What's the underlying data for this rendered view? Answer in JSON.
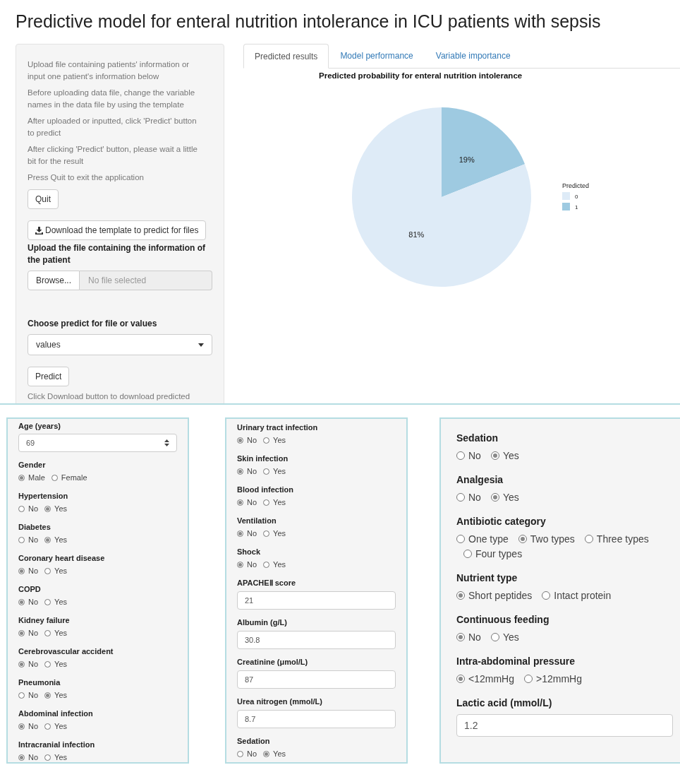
{
  "title": "Predictive model for enteral nutrition intolerance in ICU patients with sepsis",
  "sidebar": {
    "instructions": [
      "Upload file containing patients' information or input one patient's information below",
      "Before uploading data file, change the variable names in the data file by using the template",
      "After uploaded or inputted, click 'Predict' button to predict",
      "After clicking 'Predict' button, please wait a little bit for the result",
      "Press Quit to exit the application"
    ],
    "quit_button": "Quit",
    "download_button": "Download the template to predict for files",
    "upload_label": "Upload the file containing the information of the patient",
    "browse_button": "Browse...",
    "file_placeholder": "No file selected",
    "mode_label": "Choose predict for file or values",
    "mode_value": "values",
    "predict_button": "Predict",
    "download_note": "Click Download button to download predicted"
  },
  "tabs": [
    {
      "label": "Predicted results",
      "selected": true
    },
    {
      "label": "Model performance",
      "selected": false
    },
    {
      "label": "Variable importance",
      "selected": false
    }
  ],
  "chart": {
    "chart_data": {
      "type": "pie",
      "title": "Predicted probability for enteral nutrition intolerance",
      "categories": [
        "0",
        "1"
      ],
      "values": [
        81,
        19
      ],
      "value_labels": [
        "81%",
        "19%"
      ],
      "legend": {
        "title": "Predicted"
      }
    }
  },
  "panels": [
    {
      "fields": [
        {
          "kind": "number",
          "label": "Age (years)",
          "value": "69"
        },
        {
          "kind": "radio",
          "label": "Gender",
          "options": [
            {
              "label": "Male",
              "selected": true
            },
            {
              "label": "Female",
              "selected": false
            }
          ]
        },
        {
          "kind": "radio",
          "label": "Hypertension",
          "options": [
            {
              "label": "No",
              "selected": false
            },
            {
              "label": "Yes",
              "selected": true
            }
          ]
        },
        {
          "kind": "radio",
          "label": "Diabetes",
          "options": [
            {
              "label": "No",
              "selected": false
            },
            {
              "label": "Yes",
              "selected": true
            }
          ]
        },
        {
          "kind": "radio",
          "label": "Coronary heart disease",
          "options": [
            {
              "label": "No",
              "selected": true
            },
            {
              "label": "Yes",
              "selected": false
            }
          ]
        },
        {
          "kind": "radio",
          "label": "COPD",
          "options": [
            {
              "label": "No",
              "selected": true
            },
            {
              "label": "Yes",
              "selected": false
            }
          ]
        },
        {
          "kind": "radio",
          "label": "Kidney failure",
          "options": [
            {
              "label": "No",
              "selected": true
            },
            {
              "label": "Yes",
              "selected": false
            }
          ]
        },
        {
          "kind": "radio",
          "label": "Cerebrovascular accident",
          "options": [
            {
              "label": "No",
              "selected": true
            },
            {
              "label": "Yes",
              "selected": false
            }
          ]
        },
        {
          "kind": "radio",
          "label": "Pneumonia",
          "options": [
            {
              "label": "No",
              "selected": false
            },
            {
              "label": "Yes",
              "selected": true
            }
          ]
        },
        {
          "kind": "radio",
          "label": "Abdominal infection",
          "options": [
            {
              "label": "No",
              "selected": true
            },
            {
              "label": "Yes",
              "selected": false
            }
          ]
        },
        {
          "kind": "radio",
          "label": "Intracranial infection",
          "options": [
            {
              "label": "No",
              "selected": true
            },
            {
              "label": "Yes",
              "selected": false
            }
          ]
        }
      ]
    },
    {
      "fields": [
        {
          "kind": "radio",
          "label": "Urinary tract infection",
          "options": [
            {
              "label": "No",
              "selected": true
            },
            {
              "label": "Yes",
              "selected": false
            }
          ]
        },
        {
          "kind": "radio",
          "label": "Skin infection",
          "options": [
            {
              "label": "No",
              "selected": true
            },
            {
              "label": "Yes",
              "selected": false
            }
          ]
        },
        {
          "kind": "radio",
          "label": "Blood infection",
          "options": [
            {
              "label": "No",
              "selected": true
            },
            {
              "label": "Yes",
              "selected": false
            }
          ]
        },
        {
          "kind": "radio",
          "label": "Ventilation",
          "options": [
            {
              "label": "No",
              "selected": true
            },
            {
              "label": "Yes",
              "selected": false
            }
          ]
        },
        {
          "kind": "radio",
          "label": "Shock",
          "options": [
            {
              "label": "No",
              "selected": true
            },
            {
              "label": "Yes",
              "selected": false
            }
          ]
        },
        {
          "kind": "text",
          "label": "APACHEⅡ score",
          "value": "21"
        },
        {
          "kind": "text",
          "label": "Albumin (g/L)",
          "value": "30.8"
        },
        {
          "kind": "text",
          "label": "Creatinine (μmol/L)",
          "value": "87"
        },
        {
          "kind": "text",
          "label": "Urea nitrogen (mmol/L)",
          "value": "8.7"
        },
        {
          "kind": "radio",
          "label": "Sedation",
          "options": [
            {
              "label": "No",
              "selected": false
            },
            {
              "label": "Yes",
              "selected": true
            }
          ]
        }
      ]
    },
    {
      "fields": [
        {
          "kind": "radio",
          "label": "Sedation",
          "options": [
            {
              "label": "No",
              "selected": false
            },
            {
              "label": "Yes",
              "selected": true
            }
          ]
        },
        {
          "kind": "radio",
          "label": "Analgesia",
          "options": [
            {
              "label": "No",
              "selected": false
            },
            {
              "label": "Yes",
              "selected": true
            }
          ]
        },
        {
          "kind": "radio",
          "label": "Antibiotic category",
          "options": [
            {
              "label": "One type",
              "selected": false
            },
            {
              "label": "Two types",
              "selected": true
            },
            {
              "label": "Three types",
              "selected": false
            },
            {
              "label": "Four types",
              "selected": false
            }
          ]
        },
        {
          "kind": "radio",
          "label": "Nutrient type",
          "options": [
            {
              "label": "Short peptides",
              "selected": true
            },
            {
              "label": "Intact protein",
              "selected": false
            }
          ]
        },
        {
          "kind": "radio",
          "label": "Continuous feeding",
          "options": [
            {
              "label": "No",
              "selected": true
            },
            {
              "label": "Yes",
              "selected": false
            }
          ]
        },
        {
          "kind": "radio",
          "label": "Intra-abdominal pressure",
          "options": [
            {
              "label": "<12mmHg",
              "selected": true
            },
            {
              "label": ">12mmHg",
              "selected": false
            }
          ]
        },
        {
          "kind": "text",
          "label": "Lactic acid (mmol/L)",
          "value": "1.2"
        }
      ]
    }
  ]
}
